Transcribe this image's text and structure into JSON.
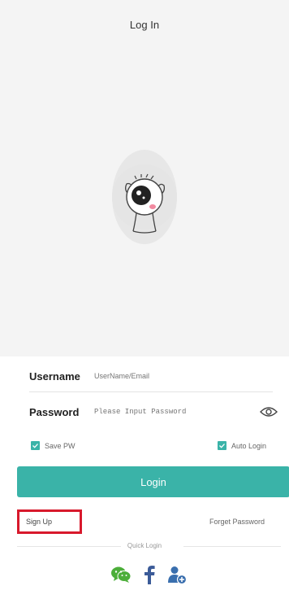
{
  "header": {
    "title": "Log In"
  },
  "form": {
    "username": {
      "label": "Username",
      "placeholder": "UserName/Email",
      "value": ""
    },
    "password": {
      "label": "Password",
      "placeholder": "Please Input Password",
      "value": ""
    },
    "save_pw": {
      "label": "Save PW",
      "checked": true
    },
    "auto_login": {
      "label": "Auto Login",
      "checked": true
    },
    "login_button": "Login",
    "sign_up": "Sign Up",
    "forget_password": "Forget Password",
    "quick_login_label": "Quick Login"
  },
  "social": [
    {
      "icon": "wechat-icon"
    },
    {
      "icon": "facebook-icon"
    },
    {
      "icon": "contact-icon"
    }
  ],
  "colors": {
    "accent": "#3ab3a8",
    "highlight_border": "#d8192c",
    "background": "#f4f4f4",
    "wechat": "#4cae3a",
    "facebook": "#3b5b98",
    "contact": "#3a6fae"
  }
}
